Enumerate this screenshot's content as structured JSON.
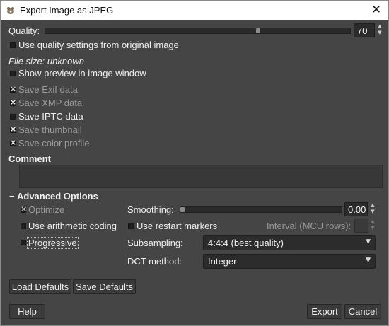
{
  "window": {
    "title": "Export Image as JPEG",
    "close_symbol": "✕"
  },
  "quality": {
    "label": "Quality:",
    "value": "70",
    "slider_fraction": 0.7
  },
  "use_quality_original": {
    "label": "Use quality settings from original image",
    "checked": false
  },
  "file_size": "File size: unknown",
  "show_preview": {
    "label": "Show preview in image window",
    "checked": false
  },
  "options": [
    {
      "label": "Save Exif data",
      "checked": true,
      "enabled": false
    },
    {
      "label": "Save XMP data",
      "checked": true,
      "enabled": false
    },
    {
      "label": "Save IPTC data",
      "checked": false,
      "enabled": true
    },
    {
      "label": "Save thumbnail",
      "checked": true,
      "enabled": false
    },
    {
      "label": "Save color profile",
      "checked": true,
      "enabled": false
    }
  ],
  "comment": {
    "label": "Comment",
    "value": ""
  },
  "advanced": {
    "title": "Advanced Options",
    "expander_symbol": "−",
    "optimize": {
      "label": "Optimize",
      "checked": true,
      "enabled": false
    },
    "arithmetic": {
      "label": "Use arithmetic coding",
      "checked": false
    },
    "progressive": {
      "label": "Progressive",
      "checked": false
    },
    "smoothing": {
      "label": "Smoothing:",
      "value": "0.00",
      "slider_fraction": 0.0
    },
    "restart_markers": {
      "label": "Use restart markers",
      "checked": false
    },
    "interval": {
      "label": "Interval (MCU rows):",
      "value": ""
    },
    "subsampling": {
      "label": "Subsampling:",
      "selected": "4:4:4 (best quality)"
    },
    "dct": {
      "label": "DCT method:",
      "selected": "Integer"
    }
  },
  "buttons": {
    "load_defaults": "Load Defaults",
    "save_defaults": "Save Defaults",
    "help": "Help",
    "export": "Export",
    "cancel": "Cancel"
  },
  "icons": {
    "app": "gimp-icon",
    "spin_up": "▲",
    "spin_down": "▼",
    "dropdown": "▼"
  }
}
